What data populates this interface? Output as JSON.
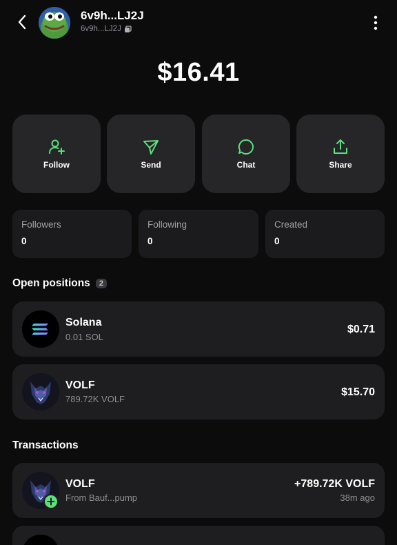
{
  "header": {
    "title": "6v9h...LJ2J",
    "subtitle": "6v9h...LJ2J"
  },
  "balance": "$16.41",
  "actions": [
    {
      "label": "Follow",
      "icon": "add-user-icon"
    },
    {
      "label": "Send",
      "icon": "send-icon"
    },
    {
      "label": "Chat",
      "icon": "chat-icon"
    },
    {
      "label": "Share",
      "icon": "share-icon"
    }
  ],
  "stats": [
    {
      "label": "Followers",
      "value": "0"
    },
    {
      "label": "Following",
      "value": "0"
    },
    {
      "label": "Created",
      "value": "0"
    }
  ],
  "positions": {
    "title": "Open positions",
    "count": "2",
    "items": [
      {
        "name": "Solana",
        "amount": "0.01 SOL",
        "value": "$0.71"
      },
      {
        "name": "VOLF",
        "amount": "789.72K VOLF",
        "value": "$15.70"
      }
    ]
  },
  "transactions": {
    "title": "Transactions",
    "items": [
      {
        "name": "VOLF",
        "detail": "From Bauf...pump",
        "amount": "+789.72K VOLF",
        "time": "38m ago"
      }
    ]
  },
  "colors": {
    "accent": "#5ee07f",
    "background": "#0c0c0d",
    "card": "#1e1e20",
    "button": "#262628"
  }
}
